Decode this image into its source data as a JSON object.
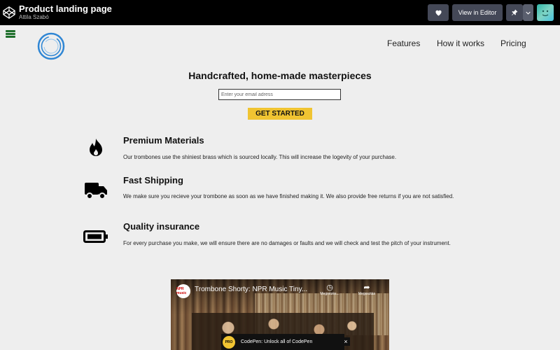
{
  "codepen": {
    "title": "Product landing page",
    "author": "Attila Szabó",
    "view_in_editor": "View in Editor"
  },
  "nav": [
    "Features",
    "How it works",
    "Pricing"
  ],
  "hero": {
    "title": "Handcrafted, home-made masterpieces",
    "email_placeholder": "Enter your email adress",
    "cta": "GET STARTED"
  },
  "features": [
    {
      "icon": "fire-icon",
      "title": "Premium Materials",
      "description": "Our trombones use the shiniest brass which is sourced locally. This will increase the logevity of your purchase."
    },
    {
      "icon": "truck-icon",
      "title": "Fast Shipping",
      "description": "We make sure you recieve your trombone as soon as we have finished making it. We also provide free returns if you are not satisfied."
    },
    {
      "icon": "battery-icon",
      "title": "Quality insurance",
      "description": "For every purchase you make, we will ensure there are no damages or faults and we will check and test the pitch of your instrument."
    }
  ],
  "video": {
    "channel_logo": "NPR music",
    "title": "Trombone Shorty: NPR Music Tiny...",
    "watch_later": "Megnézés...",
    "share": "Megosztás",
    "promo_badge": "PRO",
    "promo_text": "CodePen: Unlock all of CodePen",
    "promo_close": "×"
  }
}
